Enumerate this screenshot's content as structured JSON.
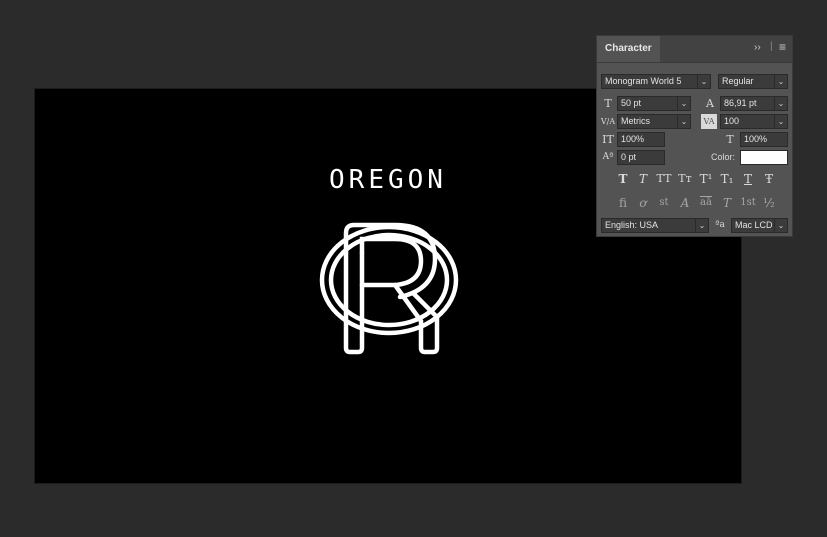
{
  "canvas": {
    "headline": "OREGON"
  },
  "panel": {
    "title": "Character",
    "collapse_glyph": "››",
    "menu_glyph": "≡",
    "font_family": "Monogram World 5",
    "font_style": "Regular",
    "font_size": "50 pt",
    "leading": "86,91 pt",
    "kerning": "Metrics",
    "tracking": "100",
    "vertical_scale": "100%",
    "horizontal_scale": "100%",
    "baseline_shift": "0 pt",
    "color_label": "Color:",
    "color_value": "#ffffff",
    "language": "English: USA",
    "antialias": "Mac LCD",
    "icons": {
      "font_size": "T",
      "leading": "A",
      "kerning": "V/A",
      "tracking": "VA",
      "vertical_scale": "IT",
      "horizontal_scale": "T",
      "baseline": "Aª",
      "antialias": "ªa"
    },
    "style_buttons": [
      "T",
      "T",
      "TT",
      "Tт",
      "T¹",
      "T₁",
      "T",
      "Ŧ"
    ],
    "opentype_buttons": [
      "ﬁ",
      "ơ",
      "st",
      "A",
      "aā",
      "T",
      "1st",
      "½"
    ],
    "arrow_glyph": "⌄"
  }
}
